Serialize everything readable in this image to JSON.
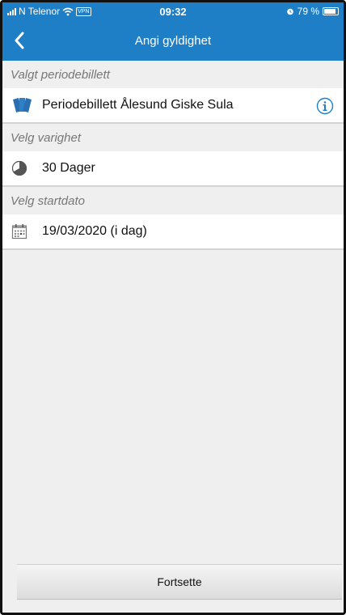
{
  "status_bar": {
    "carrier": "N Telenor",
    "vpn": "VPN",
    "time": "09:32",
    "battery": "79 %",
    "battery_level": 0.79
  },
  "nav": {
    "title": "Angi gyldighet",
    "back_icon": "chevron-left-icon"
  },
  "sections": {
    "ticket_header": "Valgt periodebillett",
    "ticket_value": "Periodebillett Ålesund Giske Sula",
    "duration_header": "Velg varighet",
    "duration_value": "30 Dager",
    "date_header": "Velg startdato",
    "date_value": "19/03/2020 (i dag)"
  },
  "footer": {
    "continue_label": "Fortsette"
  },
  "colors": {
    "brand_blue": "#1e7fc6",
    "section_bg": "#efefef",
    "header_text": "#777777"
  }
}
